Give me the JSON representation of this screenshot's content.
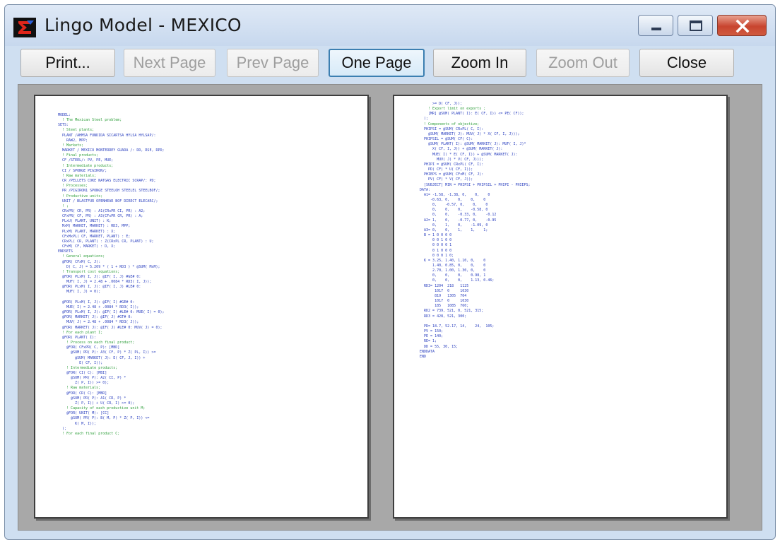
{
  "window": {
    "title": "Lingo Model - MEXICO",
    "accent_color": "#c8452f",
    "app_icon": "lingo-app-icon",
    "caption_icons": [
      "minimize-icon",
      "maximize-icon",
      "close-icon"
    ]
  },
  "toolbar": {
    "print_label": "Print...",
    "next_page_label": "Next Page",
    "prev_page_label": "Prev Page",
    "one_page_label": "One Page",
    "zoom_in_label": "Zoom In",
    "zoom_out_label": "Zoom Out",
    "close_label": "Close"
  },
  "pages": {
    "left": [
      {
        "t": "MODEL:",
        "c": "b"
      },
      {
        "t": "  ! The Mexican Steel problem;",
        "c": "g"
      },
      {
        "t": "SETS:",
        "c": "b"
      },
      {
        "t": "  ! Steel plants;",
        "c": "g"
      },
      {
        "t": "  PLANT /AHMSA FUNDIDA SICARTSA HYLSA HYLSAP/:",
        "c": "b"
      },
      {
        "t": "    RAW2, MPP;",
        "c": "b"
      },
      {
        "t": "  ! Markets;",
        "c": "g"
      },
      {
        "t": "  MARKET / MEXICO MONTERREY GUADA /: DD, RSE, RPD;",
        "c": "b"
      },
      {
        "t": "  ! Final products;",
        "c": "g"
      },
      {
        "t": "  CF /STEEL/: PV, PE, MUE;",
        "c": "b"
      },
      {
        "t": "  ! Intermediate products;",
        "c": "g"
      },
      {
        "t": "  CI / SPONGE PIGIRON/;",
        "c": "b"
      },
      {
        "t": "  ! Raw materials;",
        "c": "g"
      },
      {
        "t": "  CR /PELLETS COKE NATGAS ELECTRIC SCRAP/: PD;",
        "c": "b"
      },
      {
        "t": "  ! Processes;",
        "c": "g"
      },
      {
        "t": "  PR /PIGIRON1 SPONGE STEELOH STEELEL STEELBOF/;",
        "c": "b"
      },
      {
        "t": "  ! Productive units;",
        "c": "g"
      },
      {
        "t": "  UNIT / BLASTFUR OPENHEAR BOF DIRECT ELECARC/;",
        "c": "b"
      },
      {
        "t": "  ! ;",
        "c": "g"
      },
      {
        "t": "  CRxPR( CR, PR) : A1(CRxPR CI, PR) : A2;",
        "c": "b"
      },
      {
        "t": "  CFxPR( CF, PR) : A3(CFxPR CR, PR) : A;",
        "c": "b"
      },
      {
        "t": "  PLxU( PLANT, UNIT) : K;",
        "c": "b"
      },
      {
        "t": "  MxM( MARKET, MARKET) : RD3, MPP;",
        "c": "b"
      },
      {
        "t": "  PLxM( PLANT, MARKET) : X;",
        "c": "b"
      },
      {
        "t": "  CFxMxPL( CF, MARKET, PLANT) : E;",
        "c": "b"
      },
      {
        "t": "  CRxPL( CR, PLANT) : Z(CRxPL CR, PLANT) : U;",
        "c": "b"
      },
      {
        "t": "  CFxM( CF, MARKET) : D, X;",
        "c": "b"
      },
      {
        "t": "ENDSETS",
        "c": "b"
      },
      {
        "t": "  ! General equations;",
        "c": "g"
      },
      {
        "t": "  @FOR( CFxM( C, J):",
        "c": "b"
      },
      {
        "t": "    D( C, J) = 5.209 * ( 1 + RD3 ) * @SUM( MxM);",
        "c": "b"
      },
      {
        "t": "  ! Transport cost equations;",
        "c": "g"
      },
      {
        "t": "  @FOR( PLxM( I, J): @IF( I, J) #GE# 0:",
        "c": "b"
      },
      {
        "t": "    MUF( I, J) = 2.48 + .0084 * RD3( I, J));",
        "c": "b"
      },
      {
        "t": "  @FOR( PLxM( I, J): @IF( I, J) #LE# 0:",
        "c": "b"
      },
      {
        "t": "    MUF( I, J) = 0);",
        "c": "b"
      },
      {
        "t": "",
        "c": "b"
      },
      {
        "t": "  @FOR( PLxM( I, J): @IF( I) #GE# 0:",
        "c": "b"
      },
      {
        "t": "    MUE( I) = 2.48 + .0084 * RD3( I));",
        "c": "b"
      },
      {
        "t": "  @FOR( PLxM( I, J): @IF( I) #LE# 0: MUE( I) = 0);",
        "c": "b"
      },
      {
        "t": "  @FOR( MARKET( J): @IF( J) #GT# 0:",
        "c": "b"
      },
      {
        "t": "    MUV( J) = 2.48 + .0084 * RD3( J));",
        "c": "b"
      },
      {
        "t": "  @FOR( MARKET( J): @IF( J) #LE# 0: MUV( J) = 0);",
        "c": "b"
      },
      {
        "t": "  ! For each plant I;",
        "c": "g"
      },
      {
        "t": "  @FOR( PLANT( I):",
        "c": "b"
      },
      {
        "t": "    ! Process on each final product;",
        "c": "g"
      },
      {
        "t": "    @FOR( CFxPR( C, P): [MBD]",
        "c": "b"
      },
      {
        "t": "      @SUM( PR( P): A3( CF, P) * Z( PL, I)) >=",
        "c": "b"
      },
      {
        "t": "        @SUM( MARKET( J): E( CF, J, I)) +",
        "c": "b"
      },
      {
        "t": "          E( CF, I));",
        "c": "b"
      },
      {
        "t": "    ! Intermediate products;",
        "c": "g"
      },
      {
        "t": "    @FOR( CI( C): [MBI]",
        "c": "b"
      },
      {
        "t": "      @SUM( PR( P): A2( CI, P) *",
        "c": "b"
      },
      {
        "t": "        Z( P, I)) >= 0);",
        "c": "b"
      },
      {
        "t": "    ! Raw materials;",
        "c": "g"
      },
      {
        "t": "    @FOR( CR( C): [MBR]",
        "c": "b"
      },
      {
        "t": "      @SUM( PR( P): A1( CR, P) *",
        "c": "b"
      },
      {
        "t": "        Z( P, I)) + U( CR, I) >= 0);",
        "c": "b"
      },
      {
        "t": "    ! Capacity of each productive unit M;",
        "c": "g"
      },
      {
        "t": "    @FOR( UNIT( M): [CC]",
        "c": "b"
      },
      {
        "t": "      @SUM( PR( P): B( M, P) * Z( P, I)) <=",
        "c": "b"
      },
      {
        "t": "        K( M, I));",
        "c": "b"
      },
      {
        "t": "  );",
        "c": "b"
      },
      {
        "t": "  ! For each final product C;",
        "c": "g"
      }
    ],
    "right": [
      {
        "t": "      >= D( CF, J));",
        "c": "b"
      },
      {
        "t": "    ! Export limit on exports ;",
        "c": "g"
      },
      {
        "t": "    [MR] @SUM( PLANT( I): E( CF, I)) <= PE( CF));",
        "c": "b"
      },
      {
        "t": "  );",
        "c": "b"
      },
      {
        "t": "  ! Components of objective;",
        "c": "g"
      },
      {
        "t": "  PHIPSI = @SUM( CRxPL( C, I):",
        "c": "b"
      },
      {
        "t": "    @SUM( MARKET( J): MUV( J) * X( CF, I, J)));",
        "c": "b"
      },
      {
        "t": "  PHIPSIL = @SUM( CF( C):",
        "c": "b"
      },
      {
        "t": "    @SUM( PLANT( I): @SUM( MARKET( J): MUF( I, J)*",
        "c": "b"
      },
      {
        "t": "      X( CF, I, J)) + @SUM( MARKET( J):",
        "c": "b"
      },
      {
        "t": "      MUE( I) * E( CF, I)) + @SUM( MARKET( J):",
        "c": "b"
      },
      {
        "t": "        MUV( J) * V( CF, J)));",
        "c": "b"
      },
      {
        "t": "  PHIPI = @SUM( CRxPL( CF, I):",
        "c": "b"
      },
      {
        "t": "    PD( CF) * U( CF, I));",
        "c": "b"
      },
      {
        "t": "  PHIEPS = @SUM( CFxM( CF, J):",
        "c": "b"
      },
      {
        "t": "    PV( CF) * V( CF, J));",
        "c": "b"
      },
      {
        "t": "  [SUBJECT] MIN = PHIPSI + PHIPSIL + PHIPI - PHIEPS;",
        "c": "b"
      },
      {
        "t": "DATA:",
        "c": "b"
      },
      {
        "t": "  A1= -1.58, -1.38, 0,    0,    0",
        "c": "b"
      },
      {
        "t": "     -0.63, 0,    0,    0,    0",
        "c": "b"
      },
      {
        "t": "      0,    -0.57, 0,    0,    0",
        "c": "b"
      },
      {
        "t": "      0,    0,    0,    -0.58, 0",
        "c": "b"
      },
      {
        "t": "      0,    0,    -0.33, 0,    -0.12",
        "c": "b"
      },
      {
        "t": "  A2= 1,    0,    -0.77, 0,    -0.95",
        "c": "b"
      },
      {
        "t": "      0,    1,    0,    -1.09, 0",
        "c": "b"
      },
      {
        "t": "  A3= 0,    0,    1,    1,    1;",
        "c": "b"
      },
      {
        "t": "  B = 1 0 0 0 0",
        "c": "b"
      },
      {
        "t": "      0 0 1 0 0",
        "c": "b"
      },
      {
        "t": "      0 0 0 0 1",
        "c": "b"
      },
      {
        "t": "      0 1 0 0 0",
        "c": "b"
      },
      {
        "t": "      0 0 0 1 0;",
        "c": "b"
      },
      {
        "t": "  K = 3.25, 1.40, 1.10, 0,    0",
        "c": "b"
      },
      {
        "t": "      1.40, 0.85, 0,    0,    0",
        "c": "b"
      },
      {
        "t": "      2.70, 1.00, 1.30, 0,    0",
        "c": "b"
      },
      {
        "t": "      0,    0,    0,    0.98, 1",
        "c": "b"
      },
      {
        "t": "      0,    0,    0,    1.13, 0.46;",
        "c": "b"
      },
      {
        "t": "  RD3= 1204  218   1125",
        "c": "b"
      },
      {
        "t": "       1017  0     1030",
        "c": "b"
      },
      {
        "t": "       819   1305  704",
        "c": "b"
      },
      {
        "t": "       1017  0     1030",
        "c": "b"
      },
      {
        "t": "       185   1085  760;",
        "c": "b"
      },
      {
        "t": "  RD2 = 739, 521, 0, 521, 315;",
        "c": "b"
      },
      {
        "t": "  RD3 = 428, 521, 300;",
        "c": "b"
      },
      {
        "t": "",
        "c": "b"
      },
      {
        "t": "  PD= 18.7, 52.17, 14,    24,  105;",
        "c": "b"
      },
      {
        "t": "  PV = 150;",
        "c": "b"
      },
      {
        "t": "  PE = 140;",
        "c": "b"
      },
      {
        "t": "  RE= 1;",
        "c": "b"
      },
      {
        "t": "  DD = 55, 30, 15;",
        "c": "b"
      },
      {
        "t": "ENDDATA",
        "c": "b"
      },
      {
        "t": "END",
        "c": "b"
      }
    ]
  }
}
